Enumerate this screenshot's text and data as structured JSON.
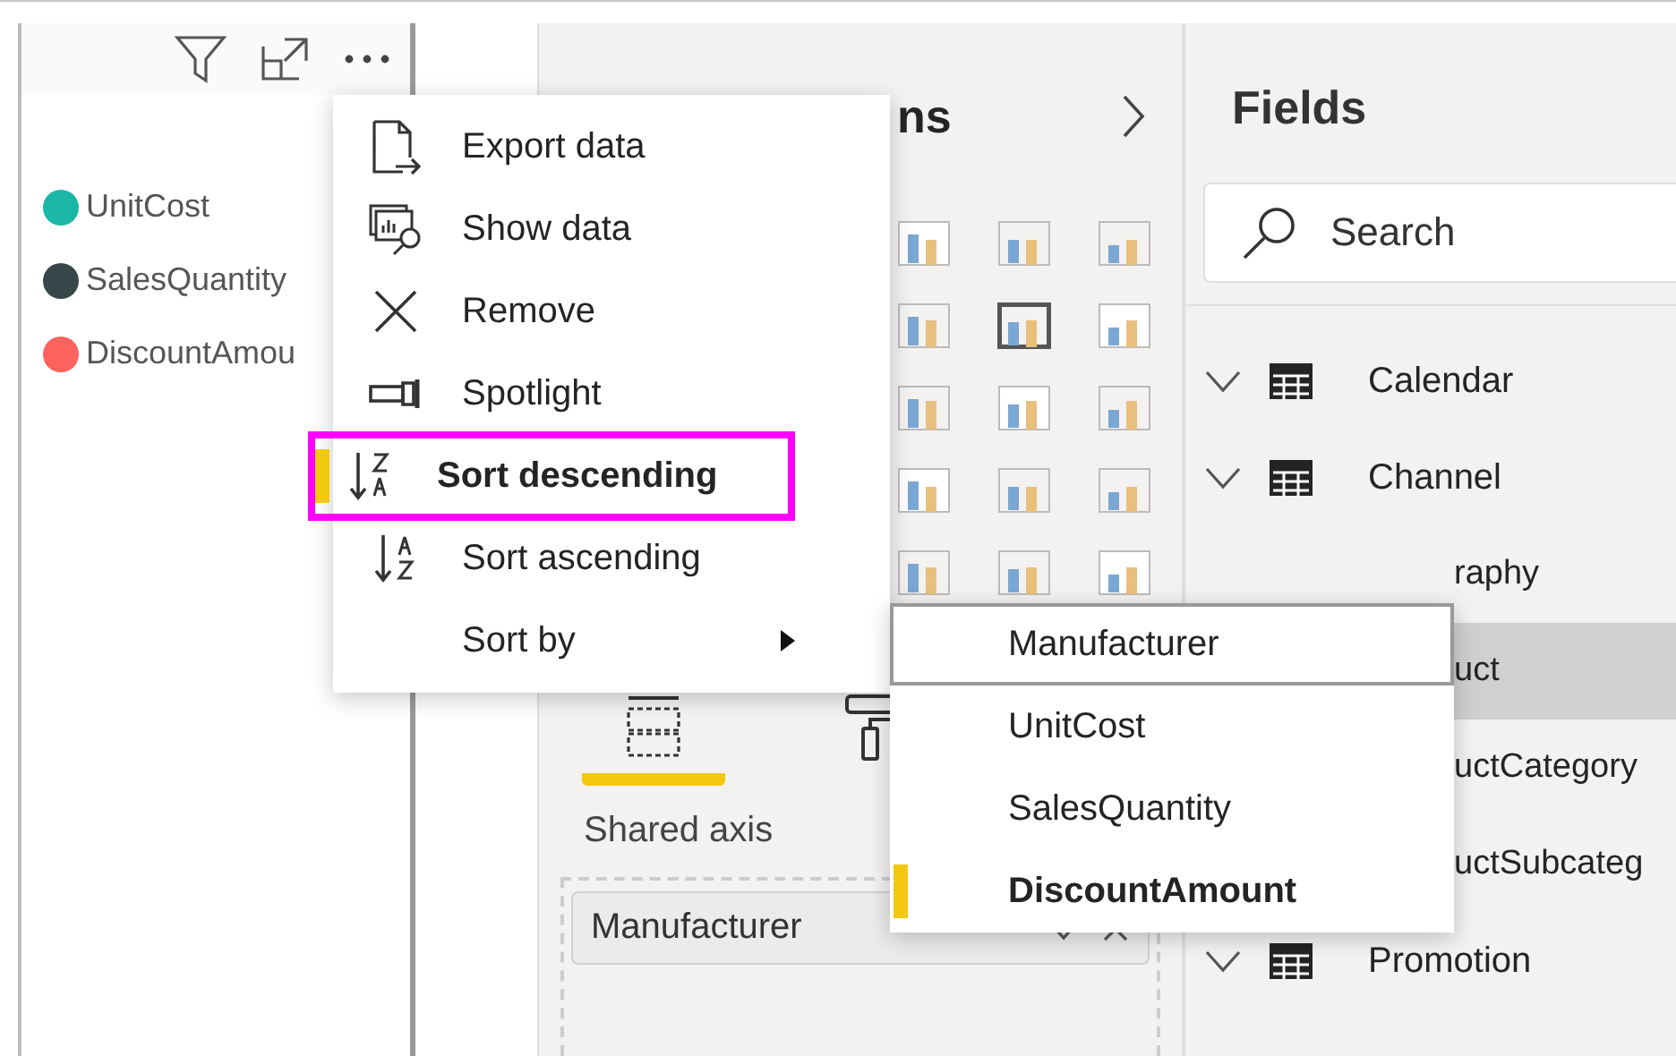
{
  "visual": {
    "legend": [
      {
        "label": "UnitCost",
        "color": "#1ab7a6"
      },
      {
        "label": "SalesQuantity",
        "color": "#374649"
      },
      {
        "label": "DiscountAmou",
        "color": "#fd625e"
      }
    ]
  },
  "context_menu": {
    "items": [
      {
        "kind": "export",
        "label": "Export data",
        "selected": false
      },
      {
        "kind": "show",
        "label": "Show data",
        "selected": false
      },
      {
        "kind": "remove",
        "label": "Remove",
        "selected": false
      },
      {
        "kind": "spotlight",
        "label": "Spotlight",
        "selected": false
      },
      {
        "kind": "sort-desc",
        "label": "Sort descending",
        "selected": true
      },
      {
        "kind": "sort-asc",
        "label": "Sort ascending",
        "selected": false
      },
      {
        "kind": "submenu",
        "label": "Sort by",
        "selected": false
      }
    ]
  },
  "sort_by_menu": {
    "items": [
      {
        "label": "Manufacturer",
        "hovered": true,
        "selected": false
      },
      {
        "label": "UnitCost",
        "hovered": false,
        "selected": false
      },
      {
        "label": "SalesQuantity",
        "hovered": false,
        "selected": false
      },
      {
        "label": "DiscountAmount",
        "hovered": false,
        "selected": true
      }
    ]
  },
  "visualizations": {
    "title": "ns",
    "tabs": [
      {
        "kind": "fields",
        "selected": true
      },
      {
        "kind": "format",
        "selected": false
      }
    ],
    "well_label": "Shared axis",
    "well_value": "Manufacturer"
  },
  "fields": {
    "title": "Fields",
    "search": {
      "placeholder": "Search"
    },
    "tables": [
      {
        "kind": "full",
        "label": "Calendar",
        "selected": false
      },
      {
        "kind": "full",
        "label": "Channel",
        "selected": false
      },
      {
        "kind": "cut",
        "label": "raphy",
        "selected": false
      },
      {
        "kind": "cut",
        "label": "uct",
        "selected": true
      },
      {
        "kind": "cut",
        "label": "uctCategory",
        "selected": false
      },
      {
        "kind": "cut",
        "label": "uctSubcateg",
        "selected": false
      },
      {
        "kind": "full",
        "label": "Promotion",
        "selected": false
      }
    ]
  }
}
